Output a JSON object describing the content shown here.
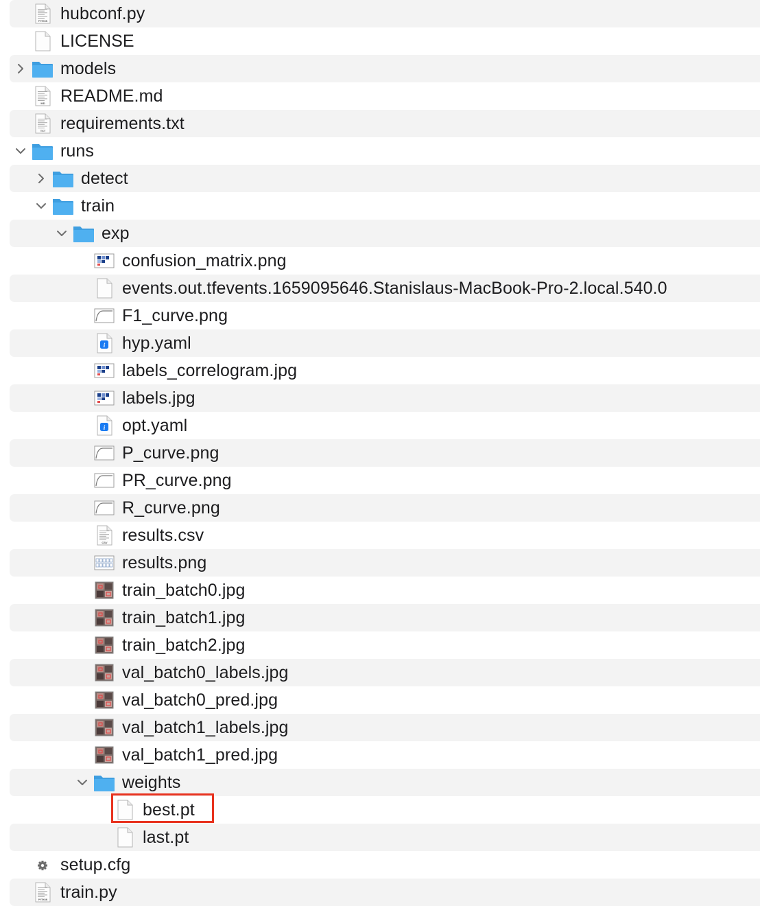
{
  "accent_color": "#e8321e",
  "folder_color": "#4fb0f0",
  "items": [
    {
      "label": "hubconf.py",
      "depth": 0,
      "icon": "python-file-icon",
      "badge": "PYTHON",
      "stripe": true
    },
    {
      "label": "LICENSE",
      "depth": 0,
      "icon": "blank-file-icon",
      "stripe": false
    },
    {
      "label": "models",
      "depth": 0,
      "icon": "folder-icon",
      "disclosure": "collapsed",
      "stripe": true
    },
    {
      "label": "README.md",
      "depth": 0,
      "icon": "markdown-file-icon",
      "badge": "MD",
      "stripe": false
    },
    {
      "label": "requirements.txt",
      "depth": 0,
      "icon": "text-file-icon",
      "badge": "TXT",
      "stripe": true
    },
    {
      "label": "runs",
      "depth": 0,
      "icon": "folder-icon",
      "disclosure": "expanded",
      "stripe": false
    },
    {
      "label": "detect",
      "depth": 1,
      "icon": "folder-icon",
      "disclosure": "collapsed",
      "stripe": true
    },
    {
      "label": "train",
      "depth": 1,
      "icon": "folder-icon",
      "disclosure": "expanded",
      "stripe": false
    },
    {
      "label": "exp",
      "depth": 2,
      "icon": "folder-icon",
      "disclosure": "expanded",
      "stripe": true
    },
    {
      "label": "confusion_matrix.png",
      "depth": 3,
      "icon": "image-thumbnail-icon",
      "stripe": false
    },
    {
      "label": "events.out.tfevents.1659095646.Stanislaus-MacBook-Pro-2.local.540.0",
      "depth": 3,
      "icon": "blank-file-icon",
      "stripe": true
    },
    {
      "label": "F1_curve.png",
      "depth": 3,
      "icon": "curve-thumbnail-icon",
      "stripe": false
    },
    {
      "label": "hyp.yaml",
      "depth": 3,
      "icon": "yaml-file-icon",
      "stripe": true
    },
    {
      "label": "labels_correlogram.jpg",
      "depth": 3,
      "icon": "image-thumbnail-icon",
      "stripe": false
    },
    {
      "label": "labels.jpg",
      "depth": 3,
      "icon": "image-thumbnail-icon",
      "stripe": true
    },
    {
      "label": "opt.yaml",
      "depth": 3,
      "icon": "yaml-file-icon",
      "stripe": false
    },
    {
      "label": "P_curve.png",
      "depth": 3,
      "icon": "curve-thumbnail-icon",
      "stripe": true
    },
    {
      "label": "PR_curve.png",
      "depth": 3,
      "icon": "curve-thumbnail-icon",
      "stripe": false
    },
    {
      "label": "R_curve.png",
      "depth": 3,
      "icon": "curve-thumbnail-icon",
      "stripe": true
    },
    {
      "label": "results.csv",
      "depth": 3,
      "icon": "csv-file-icon",
      "badge": "CSV",
      "stripe": false
    },
    {
      "label": "results.png",
      "depth": 3,
      "icon": "chart-thumbnail-icon",
      "stripe": true
    },
    {
      "label": "train_batch0.jpg",
      "depth": 3,
      "icon": "photo-thumbnail-icon",
      "stripe": false
    },
    {
      "label": "train_batch1.jpg",
      "depth": 3,
      "icon": "photo-thumbnail-icon",
      "stripe": true
    },
    {
      "label": "train_batch2.jpg",
      "depth": 3,
      "icon": "photo-thumbnail-icon",
      "stripe": false
    },
    {
      "label": "val_batch0_labels.jpg",
      "depth": 3,
      "icon": "photo-thumbnail-icon",
      "stripe": true
    },
    {
      "label": "val_batch0_pred.jpg",
      "depth": 3,
      "icon": "photo-thumbnail-icon",
      "stripe": false
    },
    {
      "label": "val_batch1_labels.jpg",
      "depth": 3,
      "icon": "photo-thumbnail-icon",
      "stripe": true
    },
    {
      "label": "val_batch1_pred.jpg",
      "depth": 3,
      "icon": "photo-thumbnail-icon",
      "stripe": false
    },
    {
      "label": "weights",
      "depth": 3,
      "icon": "folder-icon",
      "disclosure": "expanded",
      "stripe": true
    },
    {
      "label": "best.pt",
      "depth": 4,
      "icon": "blank-file-icon",
      "stripe": false,
      "highlighted": true
    },
    {
      "label": "last.pt",
      "depth": 4,
      "icon": "blank-file-icon",
      "stripe": true
    },
    {
      "label": "setup.cfg",
      "depth": 0,
      "icon": "gear-file-icon",
      "stripe": false
    },
    {
      "label": "train.py",
      "depth": 0,
      "icon": "python-file-icon",
      "badge": "PYTHON",
      "stripe": true
    }
  ]
}
